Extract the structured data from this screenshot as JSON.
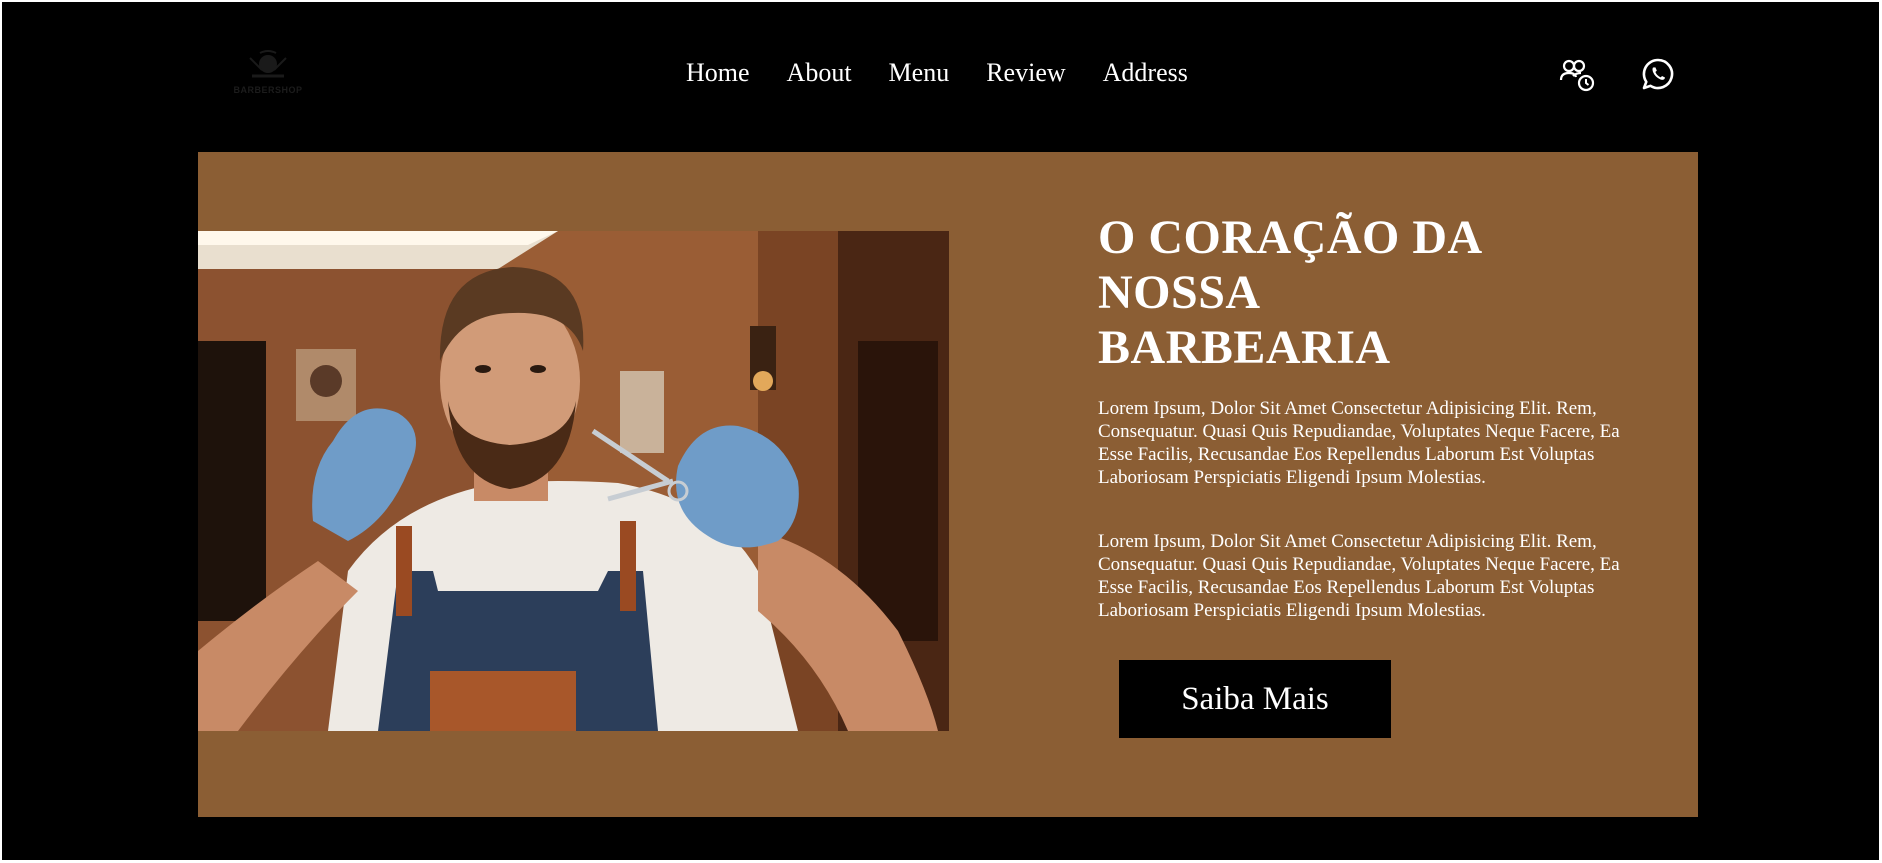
{
  "header": {
    "logo_text": "BARBERSHOP",
    "nav": [
      {
        "label": "Home"
      },
      {
        "label": "About"
      },
      {
        "label": "Menu"
      },
      {
        "label": "Review"
      },
      {
        "label": "Address"
      }
    ],
    "icons": [
      "users-clock-icon",
      "whatsapp-icon"
    ]
  },
  "hero": {
    "title": "O CORAÇÃO DA NOSSA BARBEARIA",
    "paragraphs": [
      "Lorem Ipsum, Dolor Sit Amet Consectetur Adipisicing Elit. Rem, Consequatur. Quasi Quis Repudiandae, Voluptates Neque Facere, Ea Esse Facilis, Recusandae Eos Repellendus Laborum Est Voluptas Laboriosam Perspiciatis Eligendi Ipsum Molestias.",
      "Lorem Ipsum, Dolor Sit Amet Consectetur Adipisicing Elit. Rem, Consequatur. Quasi Quis Repudiandae, Voluptates Neque Facere, Ea Esse Facilis, Recusandae Eos Repellendus Laborum Est Voluptas Laboriosam Perspiciatis Eligendi Ipsum Molestias."
    ],
    "cta_label": "Saiba Mais"
  },
  "colors": {
    "page_background": "#000000",
    "hero_background": "#8b5e34",
    "text": "#ffffff",
    "button_background": "#000000"
  }
}
